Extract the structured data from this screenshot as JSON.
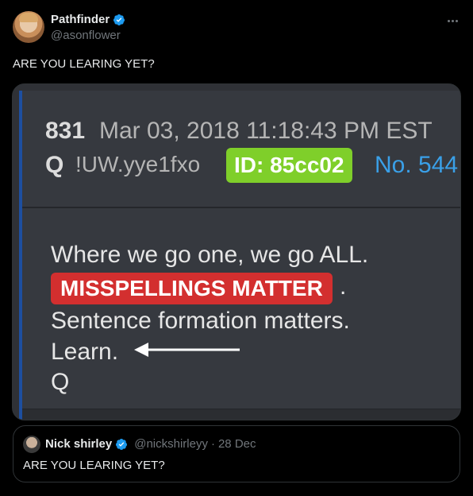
{
  "author": {
    "display_name": "Pathfinder",
    "handle": "@asonflower",
    "verified_icon": "verified-badge-icon",
    "more_icon": "more-options-icon"
  },
  "tweet": {
    "text": "ARE YOU LEARING YET?"
  },
  "media": {
    "post_number": "831",
    "date": "Mar 03, 2018 11:18:43 PM EST",
    "q_label": "Q",
    "tripcode": "!UW.yye1fxo",
    "id_badge": "ID: 85cc02",
    "no_label": "No. 544",
    "line1": "Where we go one, we go ALL.",
    "highlight": "MISSPELLINGS MATTER",
    "period": ".",
    "line3": "Sentence formation matters.",
    "line4": "Learn.",
    "line5": "Q",
    "colors": {
      "id_badge": "#7fcf2a",
      "highlight": "#d32f2f",
      "no_link": "#3aa0e8",
      "accent_border": "#1d4fa0"
    }
  },
  "quote": {
    "display_name": "Nick shirley",
    "handle": "@nickshirleyy",
    "separator": "·",
    "date": "28 Dec",
    "text": "ARE YOU LEARING YET?"
  }
}
